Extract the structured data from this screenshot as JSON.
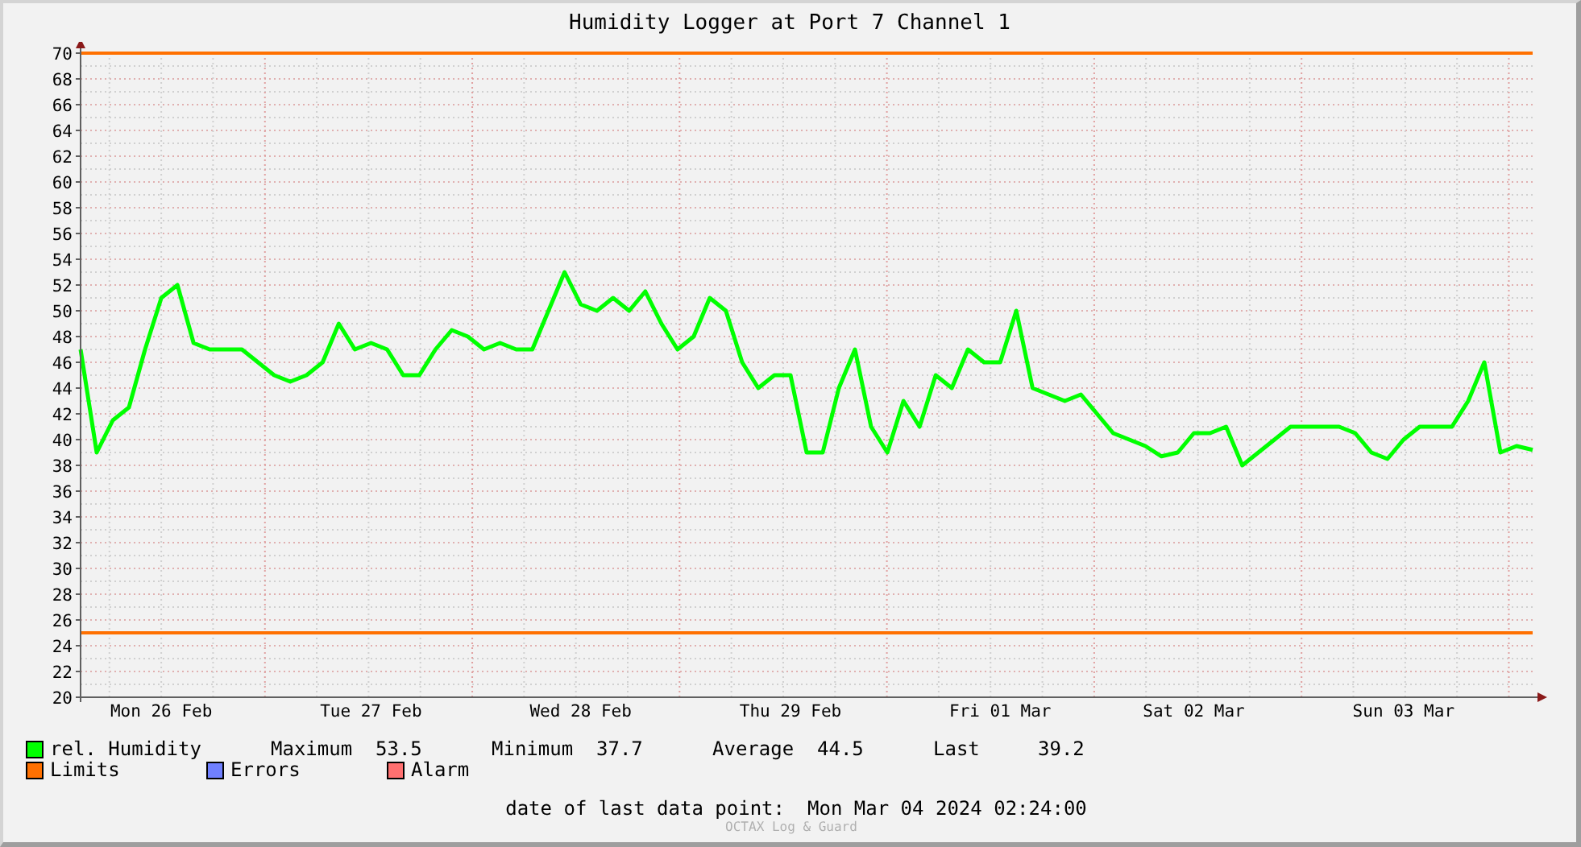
{
  "title": "Humidity Logger at Port 7 Channel 1",
  "chart_data": {
    "type": "line",
    "grid": true,
    "ylim": [
      20,
      70
    ],
    "yticks": [
      20,
      22,
      24,
      26,
      28,
      30,
      32,
      34,
      36,
      38,
      40,
      42,
      44,
      46,
      48,
      50,
      52,
      54,
      56,
      58,
      60,
      62,
      64,
      66,
      68,
      70
    ],
    "categories": [
      null,
      null,
      null,
      null,
      null,
      "Mon 26 Feb",
      null,
      null,
      null,
      null,
      null,
      null,
      null,
      null,
      null,
      null,
      null,
      null,
      "Tue 27 Feb",
      null,
      null,
      null,
      null,
      null,
      null,
      null,
      null,
      null,
      null,
      null,
      null,
      "Wed 28 Feb",
      null,
      null,
      null,
      null,
      null,
      null,
      null,
      null,
      null,
      null,
      null,
      null,
      "Thu 29 Feb",
      null,
      null,
      null,
      null,
      null,
      null,
      null,
      null,
      null,
      null,
      null,
      null,
      "Fri 01 Mar",
      null,
      null,
      null,
      null,
      null,
      null,
      null,
      null,
      null,
      null,
      null,
      "Sat 02 Mar",
      null,
      null,
      null,
      null,
      null,
      null,
      null,
      null,
      null,
      null,
      null,
      null,
      "Sun 03 Mar",
      null,
      null,
      null,
      null,
      null,
      null,
      null,
      null
    ],
    "series": [
      {
        "name": "rel. Humidity",
        "color": "#00ff00",
        "values": [
          47,
          39,
          41.5,
          42.5,
          47,
          51,
          52,
          47.5,
          47,
          47,
          47,
          46,
          45,
          44.5,
          45,
          46,
          49,
          47,
          47.5,
          47,
          45,
          45,
          47,
          48.5,
          48,
          47,
          47.5,
          47,
          47,
          50,
          53,
          50.5,
          50,
          51,
          50,
          51.5,
          49,
          47,
          48,
          51,
          50,
          46,
          44,
          45,
          45,
          39,
          39,
          44,
          47,
          41,
          39,
          43,
          41,
          45,
          44,
          47,
          46,
          46,
          50,
          44,
          43.5,
          43,
          43.5,
          42,
          40.5,
          40,
          39.5,
          38.7,
          39,
          40.5,
          40.5,
          41,
          38,
          39,
          40,
          41,
          41,
          41,
          41,
          40.5,
          39,
          38.5,
          40,
          41,
          41,
          41,
          43,
          46,
          39,
          39.5,
          39.2
        ]
      }
    ],
    "ref_lines": [
      {
        "axis": "y",
        "value": 70,
        "color": "#ff7000"
      },
      {
        "axis": "y",
        "value": 25,
        "color": "#ff7000"
      }
    ]
  },
  "legend": {
    "stats": [
      {
        "label": "Maximum",
        "value": "53.5"
      },
      {
        "label": "Minimum",
        "value": "37.7"
      },
      {
        "label": "Average",
        "value": "44.5"
      },
      {
        "label": "Last",
        "value": "39.2"
      }
    ],
    "items": [
      {
        "label": "Limits",
        "color": "#ff7000"
      },
      {
        "label": "Errors",
        "color": "#7080ff"
      },
      {
        "label": "Alarm",
        "color": "#ff7070"
      }
    ]
  },
  "footer": {
    "label": "date of last data point:",
    "value": "Mon Mar 04 2024 02:24:00"
  },
  "watermark": "OCTAX Log & Guard"
}
